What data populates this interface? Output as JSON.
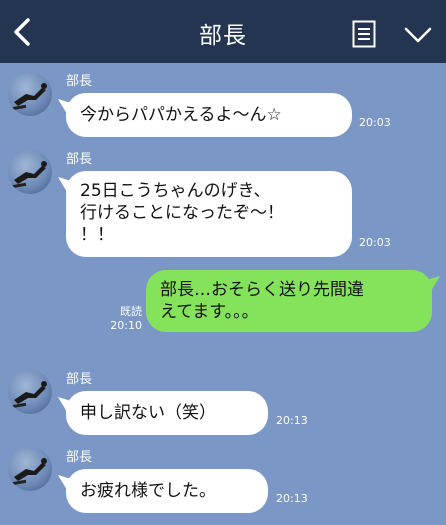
{
  "header": {
    "title": "部長",
    "back_icon": "chevron-left-icon",
    "menu_icon": "note-list-icon",
    "dropdown_icon": "chevron-down-icon"
  },
  "messages": [
    {
      "sender": "部長",
      "text": "今からパパかえるよ～ん☆",
      "time": "20:03"
    },
    {
      "sender": "部長",
      "lines": [
        "25日こうちゃんのげき、",
        "行けることになったぞ～！",
        "！！"
      ],
      "time": "20:03"
    },
    {
      "lines": [
        "部長…おそらく送り先間違",
        "えてます。。。"
      ],
      "read": "既読",
      "time": "20:10"
    },
    {
      "sender": "部長",
      "text": "申し訳ない（笑）",
      "time": "20:13"
    },
    {
      "sender": "部長",
      "text": "お疲れ様でした。",
      "time": "20:13"
    }
  ],
  "colors": {
    "background": "#7a97c6",
    "header": "#243552",
    "outgoing_bubble": "#84e35a",
    "incoming_bubble": "#ffffff"
  }
}
